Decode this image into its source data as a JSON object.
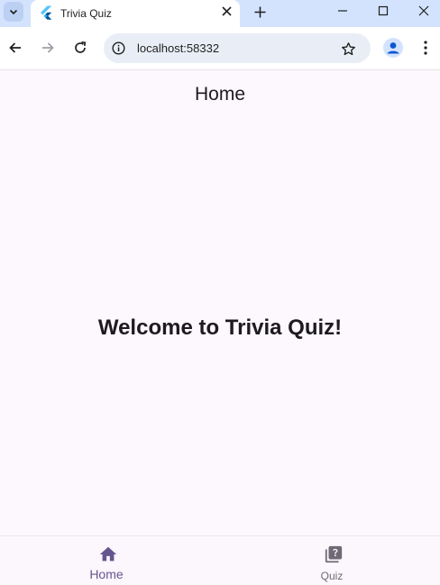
{
  "browser": {
    "tab": {
      "title": "Trivia Quiz",
      "favicon": "flutter-logo-icon"
    },
    "url": "localhost:58332",
    "colors": {
      "tabstrip": "#d3e3fd",
      "omnibox": "#e9eef6",
      "profile": "#0b57d0"
    }
  },
  "app": {
    "appbar_title": "Home",
    "welcome_text": "Welcome to Trivia Quiz!",
    "colors": {
      "background": "#fdf7fe",
      "primary": "#65558f",
      "inactive": "#6f6a75"
    }
  },
  "bottom_nav": {
    "items": [
      {
        "label": "Home",
        "icon": "home-icon",
        "selected": true
      },
      {
        "label": "Quiz",
        "icon": "quiz-icon",
        "selected": false
      }
    ]
  }
}
